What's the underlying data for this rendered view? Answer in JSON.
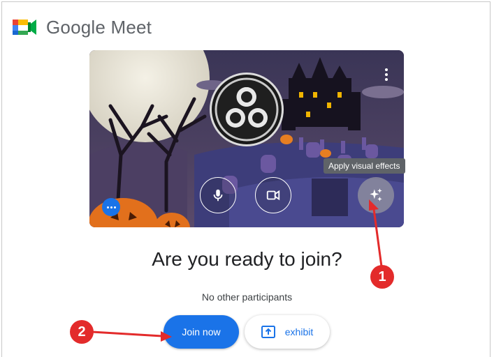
{
  "app": {
    "brand": "Google Meet"
  },
  "preview": {
    "tooltip": "Apply visual effects",
    "controls": {
      "mic": "microphone-icon",
      "camera": "camera-icon",
      "effects": "sparkle-icon",
      "more": "more-options-icon"
    }
  },
  "main": {
    "title": "Are you ready to join?",
    "participants": "No other participants",
    "join_label": "Join now",
    "present_label": "exhibit"
  },
  "annotations": {
    "badge1": "1",
    "badge2": "2"
  },
  "colors": {
    "accent": "#1a73e8",
    "annotation": "#e32b2b",
    "tooltip_bg": "#5f6368"
  }
}
